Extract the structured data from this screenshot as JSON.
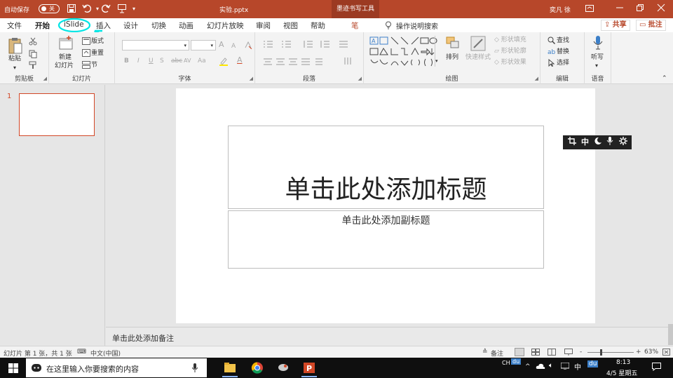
{
  "titlebar": {
    "autosave_label": "自动保存",
    "autosave_state": "关",
    "filename": "实验.pptx",
    "context_tab": "墨迹书写工具",
    "user": "奕凡 徐"
  },
  "tabs": {
    "items": [
      "文件",
      "开始",
      "iSlide",
      "插入",
      "设计",
      "切换",
      "动画",
      "幻灯片放映",
      "审阅",
      "视图",
      "帮助",
      "笔"
    ],
    "active": "开始",
    "tell_me": "操作说明搜索",
    "share": "共享",
    "comment": "批注"
  },
  "ribbon": {
    "clipboard": {
      "paste": "粘贴",
      "label": "剪贴板"
    },
    "slides": {
      "new_slide_1": "新建",
      "new_slide_2": "幻灯片",
      "layout": "版式",
      "reset": "重置",
      "section": "节",
      "label": "幻灯片"
    },
    "font": {
      "label": "字体",
      "bold": "B",
      "italic": "I",
      "underline": "U",
      "strike": "S",
      "grow": "A",
      "shrink": "A",
      "spacing": "AV",
      "case": "Aa",
      "color": "A"
    },
    "paragraph": {
      "label": "段落"
    },
    "drawing": {
      "arrange": "排列",
      "quick_styles": "快速样式",
      "fill": "形状填充",
      "outline": "形状轮廓",
      "effects": "形状效果",
      "label": "绘图"
    },
    "editing": {
      "find": "查找",
      "replace": "替换",
      "select": "选择",
      "label": "编辑"
    },
    "voice": {
      "dictate": "听写",
      "label": "语音"
    }
  },
  "slide_panel": {
    "slide_number": "1"
  },
  "slide": {
    "title_placeholder": "单击此处添加标题",
    "subtitle_placeholder": "单击此处添加副标题"
  },
  "floating_toolbar": {
    "zh": "中"
  },
  "notes": {
    "placeholder": "单击此处添加备注"
  },
  "statusbar": {
    "slide_info": "幻灯片 第 1 张，共 1 张",
    "language": "中文(中国)",
    "notes_btn": "备注",
    "zoom_value": "63%",
    "zoom_fraction": 0.63,
    "minus": "-",
    "plus": "+"
  },
  "taskbar": {
    "search_placeholder": "在这里输入你要搜索的内容",
    "ime": "CH",
    "ime_mode": "中",
    "time": "8:13",
    "date": "4/5 星期五",
    "du": "du"
  },
  "colors": {
    "brand": "#b7472a",
    "annotation": "#00e5e5",
    "taskbar": "#0f0f0f"
  }
}
